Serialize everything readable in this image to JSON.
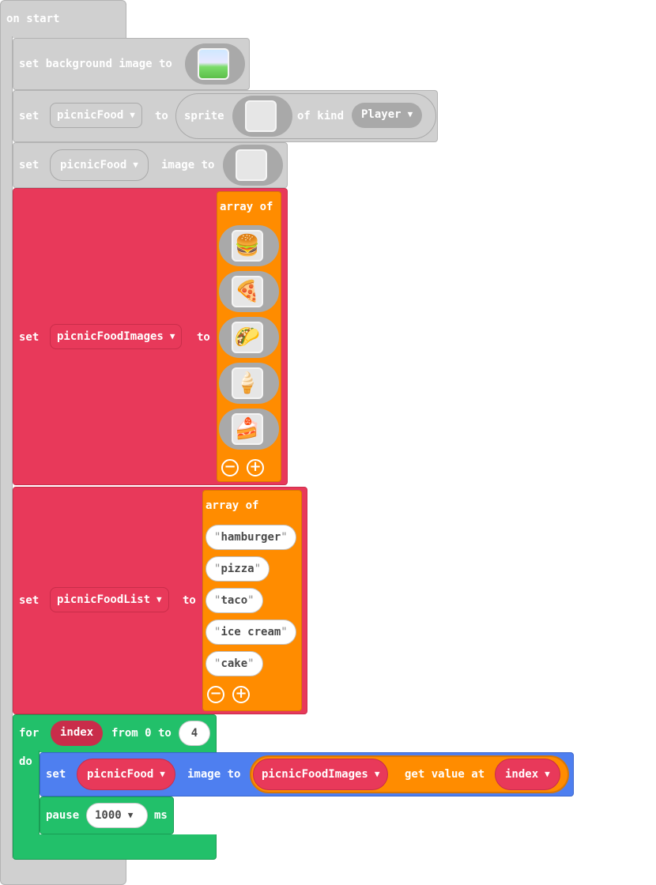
{
  "on_start": {
    "label": "on start"
  },
  "set_bg": {
    "label": "set background image to",
    "icon": "background-scene-icon"
  },
  "set_sprite": {
    "set": "set",
    "var": "picnicFood",
    "to": "to",
    "sprite": "sprite",
    "of_kind": "of kind",
    "kind": "Player"
  },
  "set_sprite_image": {
    "set": "set",
    "var": "picnicFood",
    "image_to": "image to"
  },
  "set_images": {
    "set": "set",
    "var": "picnicFoodImages",
    "to": "to",
    "array_of": "array of",
    "items": [
      "hamburger-image",
      "pizza-image",
      "taco-image",
      "ice-cream-image",
      "cake-image"
    ],
    "glyphs": [
      "🍔",
      "🍕",
      "🌮",
      "🍦",
      "🍰"
    ]
  },
  "set_list": {
    "set": "set",
    "var": "picnicFoodList",
    "to": "to",
    "array_of": "array of",
    "items": [
      "hamburger",
      "pizza",
      "taco",
      "ice cream",
      "cake"
    ]
  },
  "for_loop": {
    "for": "for",
    "var": "index",
    "from": "from 0 to",
    "end": "4",
    "do": "do"
  },
  "loop_set": {
    "set": "set",
    "var": "picnicFood",
    "image_to": "image to",
    "array_var": "picnicFoodImages",
    "get_value_at": "get value at",
    "index_var": "index"
  },
  "pause": {
    "label": "pause",
    "value": "1000",
    "unit": "ms"
  },
  "colors": {
    "events": "#d0d0d0",
    "variables": "#e8395a",
    "arrays": "#ff8c00",
    "loops": "#22c06a",
    "sprites": "#4e7ff0"
  }
}
